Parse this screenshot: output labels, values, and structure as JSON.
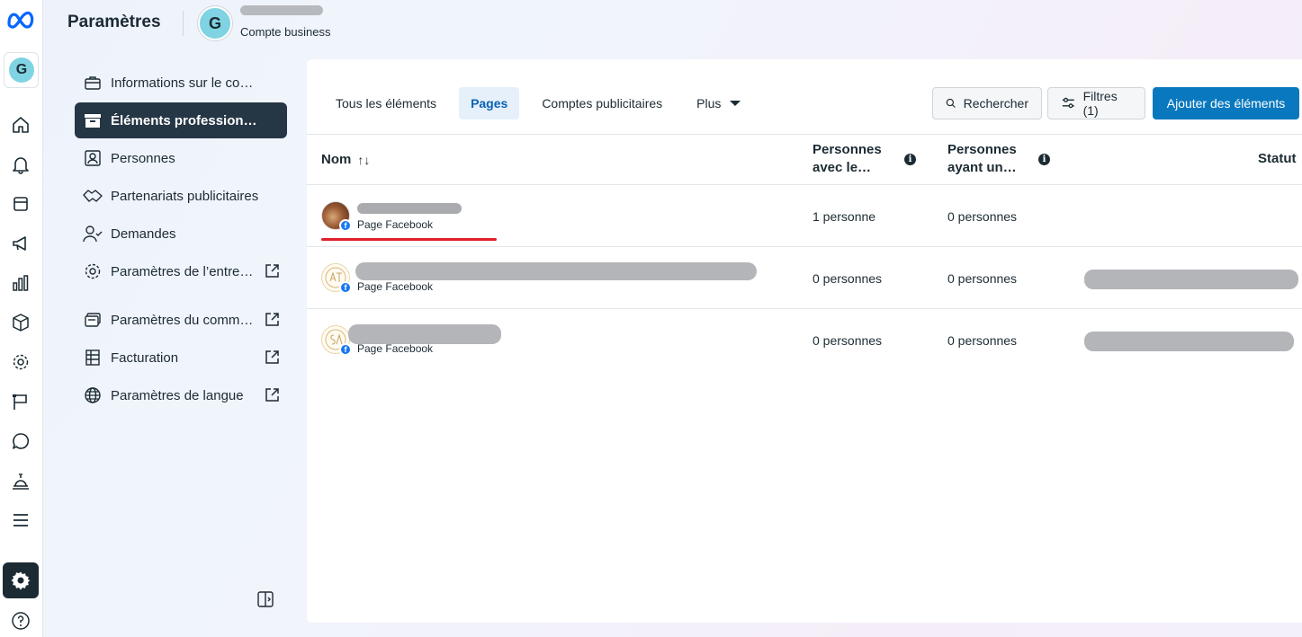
{
  "rail": {
    "account_initial": "G",
    "icons": [
      "home-icon",
      "bell-icon",
      "pages-icon",
      "megaphone-icon",
      "chart-icon",
      "box-icon",
      "gear-icon",
      "flag-icon",
      "chat-icon",
      "service-bell-icon",
      "menu-icon"
    ],
    "active_bottom_icon": "settings-gear-icon",
    "help_icon": "help-icon"
  },
  "header": {
    "title": "Paramètres",
    "business_initial": "G",
    "business_type": "Compte business"
  },
  "nav": {
    "items": [
      {
        "label": "Informations sur le compte",
        "icon": "briefcase-icon",
        "external": false,
        "active": false
      },
      {
        "label": "Éléments professionnels",
        "icon": "archive-box-icon",
        "external": false,
        "active": true
      },
      {
        "label": "Personnes",
        "icon": "people-icon",
        "external": false,
        "active": false
      },
      {
        "label": "Partenariats publicitaires",
        "icon": "handshake-icon",
        "external": false,
        "active": false
      },
      {
        "label": "Demandes",
        "icon": "person-check-icon",
        "external": false,
        "active": false
      },
      {
        "label": "Paramètres de l’entreprise",
        "icon": "gear-icon",
        "external": true,
        "active": false
      },
      {
        "label": "Paramètres du commerce",
        "icon": "shop-icon",
        "external": true,
        "active": false
      },
      {
        "label": "Facturation",
        "icon": "billing-icon",
        "external": true,
        "active": false
      },
      {
        "label": "Paramètres de langue",
        "icon": "globe-icon",
        "external": true,
        "active": false
      }
    ]
  },
  "tabs": [
    {
      "label": "Tous les éléments",
      "active": false
    },
    {
      "label": "Pages",
      "active": true
    },
    {
      "label": "Comptes publicitaires",
      "active": false
    },
    {
      "label": "Plus",
      "active": false
    }
  ],
  "toolbar": {
    "search_label": "Rechercher",
    "filters_label": "Filtres (1)",
    "add_label": "Ajouter des éléments"
  },
  "table": {
    "columns": {
      "name": "Nom",
      "people_with_line1": "Personnes",
      "people_with_line2": "avec le…",
      "people_having_line1": "Personnes",
      "people_having_line2": "ayant un…",
      "status": "Statut"
    },
    "rows": [
      {
        "type": "Page Facebook",
        "people_with": "1 personne",
        "people_having": "0 personnes"
      },
      {
        "type": "Page Facebook",
        "people_with": "0 personnes",
        "people_having": "0 personnes"
      },
      {
        "type": "Page Facebook",
        "people_with": "0 personnes",
        "people_having": "0 personnes"
      }
    ]
  },
  "colors": {
    "active_nav_bg": "#253645",
    "primary_button": "#0a78be",
    "active_tab_bg": "#e5f0fa",
    "active_tab_text": "#0a62b5",
    "facebook_blue": "#1877f2",
    "highlight_underline": "#e0202a"
  }
}
